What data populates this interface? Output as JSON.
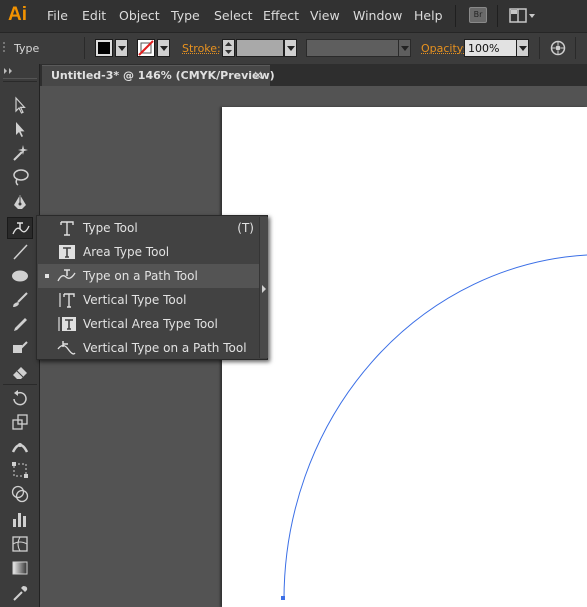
{
  "app": {
    "logo_text": "Ai"
  },
  "menubar": {
    "items": [
      "File",
      "Edit",
      "Object",
      "Type",
      "Select",
      "Effect",
      "View",
      "Window",
      "Help"
    ],
    "bridge_label": "Br"
  },
  "control_bar": {
    "tool_name": "Type",
    "stroke_label": "Stroke:",
    "opacity_label": "Opacity:",
    "opacity_value": "100%",
    "fill_color": "#000000",
    "label_color": "#e8921f"
  },
  "document": {
    "tab_title": "Untitled-3* @ 146% (CMYK/Preview)",
    "close_label": "×"
  },
  "flyout": {
    "items": [
      {
        "label": "Type Tool",
        "shortcut": "(T)",
        "icon": "type-icon",
        "selected": false
      },
      {
        "label": "Area Type Tool",
        "shortcut": "",
        "icon": "area-type-icon",
        "selected": false
      },
      {
        "label": "Type on a Path Tool",
        "shortcut": "",
        "icon": "type-on-path-icon",
        "selected": true
      },
      {
        "label": "Vertical Type Tool",
        "shortcut": "",
        "icon": "vertical-type-icon",
        "selected": false
      },
      {
        "label": "Vertical Area Type Tool",
        "shortcut": "",
        "icon": "vertical-area-type-icon",
        "selected": false
      },
      {
        "label": "Vertical Type on a Path Tool",
        "shortcut": "",
        "icon": "vertical-type-on-path-icon",
        "selected": false
      }
    ]
  },
  "canvas": {
    "path_color": "#3b6fe6"
  }
}
